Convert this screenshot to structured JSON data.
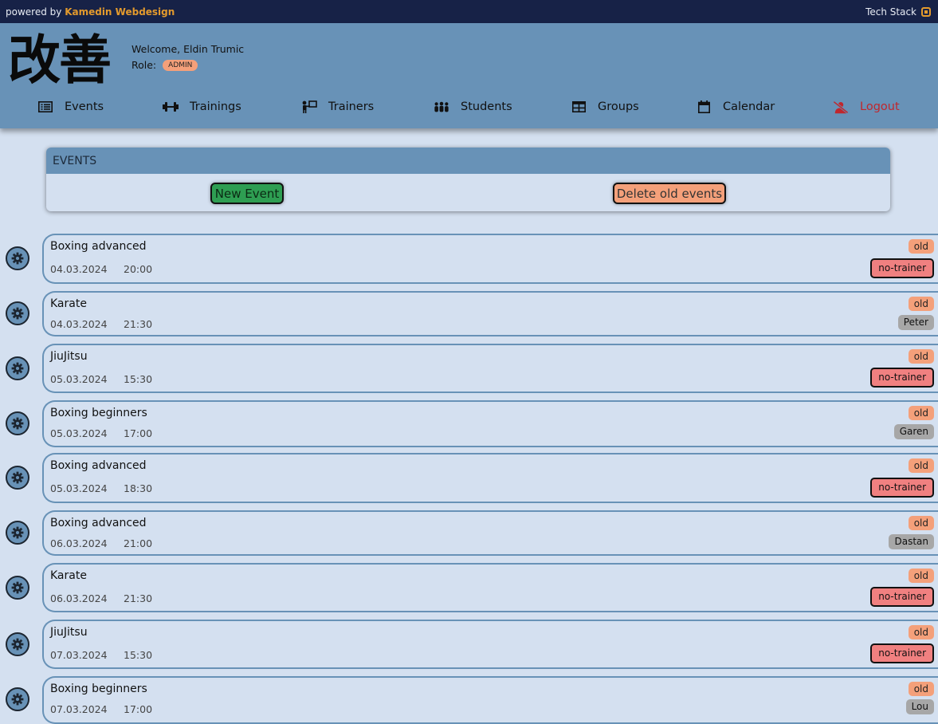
{
  "topbar": {
    "powered_prefix": "powered by",
    "brand": "Kamedin Webdesign",
    "tech_stack": "Tech Stack"
  },
  "header": {
    "logo_text": "改善",
    "welcome": "Welcome, Eldin Trumic",
    "role_label": "Role:",
    "role_value": "ADMIN"
  },
  "nav": [
    {
      "label": "Events",
      "icon": "list-icon"
    },
    {
      "label": "Trainings",
      "icon": "dumbbell-icon"
    },
    {
      "label": "Trainers",
      "icon": "trainer-icon"
    },
    {
      "label": "Students",
      "icon": "students-icon"
    },
    {
      "label": "Groups",
      "icon": "table-icon"
    },
    {
      "label": "Calendar",
      "icon": "calendar-icon"
    },
    {
      "label": "Logout",
      "icon": "user-slash-icon"
    }
  ],
  "panel": {
    "title": "EVENTS",
    "new_event": "New Event",
    "delete_old": "Delete old events"
  },
  "events": [
    {
      "title": "Boxing advanced",
      "date": "04.03.2024",
      "time": "20:00",
      "status": "old",
      "trainer": "no-trainer"
    },
    {
      "title": "Karate",
      "date": "04.03.2024",
      "time": "21:30",
      "status": "old",
      "trainer": "Peter"
    },
    {
      "title": "JiuJitsu",
      "date": "05.03.2024",
      "time": "15:30",
      "status": "old",
      "trainer": "no-trainer"
    },
    {
      "title": "Boxing beginners",
      "date": "05.03.2024",
      "time": "17:00",
      "status": "old",
      "trainer": "Garen"
    },
    {
      "title": "Boxing advanced",
      "date": "05.03.2024",
      "time": "18:30",
      "status": "old",
      "trainer": "no-trainer"
    },
    {
      "title": "Boxing advanced",
      "date": "06.03.2024",
      "time": "21:00",
      "status": "old",
      "trainer": "Dastan"
    },
    {
      "title": "Karate",
      "date": "06.03.2024",
      "time": "21:30",
      "status": "old",
      "trainer": "no-trainer"
    },
    {
      "title": "JiuJitsu",
      "date": "07.03.2024",
      "time": "15:30",
      "status": "old",
      "trainer": "no-trainer"
    },
    {
      "title": "Boxing beginners",
      "date": "07.03.2024",
      "time": "17:00",
      "status": "old",
      "trainer": "Lou"
    }
  ],
  "colors": {
    "header": "#6892b7",
    "topbar": "#172247",
    "brand": "#e39a2d",
    "old": "#f4a07a",
    "no_trainer": "#f08080",
    "trainer": "#a7a7a7",
    "logout": "#c0272d"
  }
}
